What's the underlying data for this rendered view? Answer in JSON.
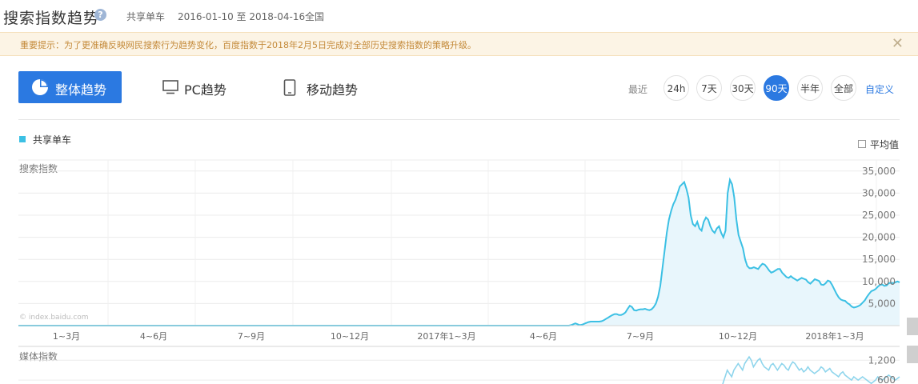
{
  "header": {
    "title": "搜索指数趋势",
    "help": "?",
    "keyword": "共享单车",
    "date_range": "2016-01-10 至 2018-04-16",
    "region": "全国"
  },
  "notice": {
    "text": "重要提示：为了更准确反映网民搜索行为趋势变化，百度指数于2018年2月5日完成对全部历史搜索指数的策略升级。",
    "close": "✕"
  },
  "tabs": {
    "overall": "整体趋势",
    "pc": "PC趋势",
    "mobile": "移动趋势"
  },
  "range": {
    "label": "最近",
    "options": [
      "24h",
      "7天",
      "30天",
      "90天",
      "半年",
      "全部"
    ],
    "active": "90天",
    "custom": "自定义"
  },
  "legend": {
    "series": "共享单车",
    "average": "平均值"
  },
  "watermark": "© index.baidu.com",
  "colors": {
    "accent": "#2b79e1",
    "series": "#3cc0e4",
    "fill": "#e8f6fc"
  },
  "chart_data": [
    {
      "type": "area",
      "ylabel": "搜索指数",
      "y_ticks": [
        "5,000",
        "10,000",
        "15,000",
        "20,000",
        "25,000",
        "30,000",
        "35,000"
      ],
      "ylim": [
        0,
        37500
      ],
      "x_tick_labels": [
        "1~3月",
        "4~6月",
        "7~9月",
        "10~12月",
        "2017年1~3月",
        "4~6月",
        "7~9月",
        "10~12月",
        "2018年1~3月"
      ],
      "series": [
        {
          "name": "共享单车",
          "values": [
            0,
            0,
            0,
            0,
            0,
            0,
            0,
            0,
            0,
            0,
            0,
            0,
            0,
            0,
            0,
            0,
            0,
            0,
            0,
            0,
            0,
            0,
            0,
            0,
            0,
            0,
            0,
            0,
            0,
            0,
            0,
            0,
            0,
            0,
            0,
            0,
            0,
            0,
            0,
            0,
            0,
            0,
            0,
            0,
            0,
            0,
            0,
            0,
            0,
            0,
            0,
            0,
            0,
            0,
            0,
            0,
            0,
            0,
            0,
            0,
            0,
            0,
            0,
            0,
            0,
            0,
            0,
            0,
            0,
            0,
            0,
            0,
            0,
            0,
            0,
            0,
            0,
            0,
            0,
            0,
            0,
            0,
            0,
            0,
            0,
            0,
            0,
            0,
            0,
            0,
            0,
            0,
            0,
            0,
            0,
            0,
            0,
            0,
            0,
            0,
            0,
            0,
            0,
            0,
            0,
            0,
            0,
            0,
            0,
            0,
            0,
            0,
            0,
            0,
            0,
            0,
            0,
            0,
            0,
            0,
            0,
            0,
            0,
            0,
            0,
            0,
            0,
            0,
            0,
            0,
            0,
            0,
            0,
            0,
            0,
            0,
            0,
            0,
            0,
            0,
            0,
            0,
            0,
            0,
            0,
            0,
            0,
            0,
            0,
            0,
            0,
            0,
            0,
            0,
            0,
            0,
            0,
            0,
            0,
            0,
            0,
            0,
            0,
            0,
            0,
            0,
            0,
            0,
            0,
            0,
            0,
            0,
            0,
            0,
            0,
            0,
            0,
            0,
            0,
            0,
            0,
            0,
            0,
            0,
            0,
            0,
            0,
            0,
            0,
            0,
            0,
            0,
            0,
            0,
            0,
            0,
            0,
            0,
            0,
            0,
            0,
            0,
            0,
            0,
            0,
            0,
            0,
            0,
            0,
            0,
            0,
            0,
            0,
            0,
            0,
            0,
            0,
            0,
            0,
            0,
            0,
            0,
            0,
            0,
            0,
            0,
            0,
            0,
            0,
            0,
            0,
            0,
            0,
            0,
            0,
            0,
            0,
            0,
            0,
            0,
            0,
            0,
            0,
            0,
            0,
            0,
            0,
            0,
            0,
            0,
            0,
            0,
            0,
            0,
            100,
            300,
            500,
            300,
            100,
            200,
            400,
            600,
            800,
            900,
            900,
            900,
            900,
            900,
            1000,
            1200,
            1500,
            1800,
            2100,
            2400,
            2600,
            2600,
            2400,
            2400,
            2600,
            3000,
            3800,
            4500,
            4200,
            3500,
            3400,
            3600,
            3700,
            3700,
            3800,
            3600,
            3500,
            3700,
            4200,
            5000,
            6500,
            9000,
            13000,
            17000,
            21000,
            24000,
            26000,
            27500,
            28500,
            30000,
            31500,
            32000,
            32500,
            31000,
            29000,
            25000,
            23000,
            22500,
            23500,
            22000,
            21500,
            23500,
            24500,
            24000,
            22500,
            21500,
            21000,
            22000,
            22500,
            21000,
            20000,
            21500,
            30000,
            33000,
            32000,
            29000,
            24000,
            20500,
            19000,
            17500,
            15000,
            13500,
            13000,
            13000,
            13200,
            13000,
            12800,
            13500,
            14000,
            13800,
            13200,
            12500,
            12000,
            12200,
            12500,
            12800,
            12800,
            12000,
            11500,
            11000,
            10800,
            11200,
            10800,
            10500,
            10200,
            10500,
            10800,
            10600,
            10400,
            9800,
            9500,
            10000,
            10500,
            10300,
            10100,
            9300,
            9200,
            9600,
            10200,
            10000,
            9200,
            8200,
            7200,
            6400,
            5900,
            5700,
            5600,
            5100,
            4800,
            4300,
            4100,
            4200,
            4400,
            4700,
            5200,
            5700,
            6500,
            7200,
            7800,
            8000,
            8300,
            8800,
            9200,
            9300,
            9000,
            9100,
            9600,
            9700,
            9600,
            9800,
            10000,
            9800
          ]
        }
      ]
    },
    {
      "type": "line",
      "ylabel": "媒体指数",
      "y_ticks": [
        "600",
        "1,200"
      ],
      "series": [
        {
          "name": "共享单车",
          "values": [
            0,
            0,
            0,
            0,
            0,
            0,
            0,
            0,
            0,
            0,
            0,
            0,
            0,
            0,
            0,
            0,
            0,
            0,
            0,
            0,
            0,
            0,
            0,
            0,
            0,
            0,
            0,
            0,
            0,
            0,
            0,
            0,
            0,
            0,
            0,
            0,
            0,
            0,
            0,
            0,
            0,
            0,
            0,
            0,
            0,
            0,
            0,
            0,
            0,
            0,
            0,
            0,
            0,
            0,
            0,
            0,
            0,
            0,
            0,
            0,
            0,
            0,
            0,
            0,
            0,
            0,
            0,
            0,
            0,
            0,
            0,
            0,
            0,
            0,
            0,
            0,
            0,
            0,
            0,
            0,
            0,
            0,
            0,
            0,
            0,
            0,
            0,
            0,
            0,
            0,
            0,
            0,
            0,
            0,
            0,
            0,
            0,
            0,
            0,
            0,
            0,
            0,
            0,
            0,
            0,
            0,
            0,
            0,
            0,
            0,
            0,
            0,
            0,
            0,
            0,
            0,
            0,
            0,
            0,
            0,
            0,
            0,
            0,
            0,
            0,
            0,
            0,
            0,
            0,
            0,
            0,
            0,
            0,
            0,
            0,
            0,
            0,
            0,
            0,
            0,
            0,
            0,
            0,
            0,
            0,
            0,
            0,
            0,
            0,
            0,
            0,
            0,
            0,
            0,
            0,
            0,
            0,
            0,
            0,
            0,
            0,
            0,
            0,
            0,
            0,
            0,
            0,
            0,
            0,
            0,
            0,
            0,
            0,
            0,
            0,
            0,
            0,
            0,
            0,
            0,
            0,
            0,
            0,
            0,
            0,
            0,
            0,
            0,
            0,
            0,
            0,
            0,
            0,
            0,
            0,
            0,
            0,
            0,
            0,
            0,
            0,
            0,
            0,
            0,
            0,
            0,
            0,
            0,
            0,
            0,
            0,
            0,
            0,
            0,
            0,
            0,
            0,
            0,
            0,
            0,
            0,
            0,
            0,
            0,
            0,
            0,
            0,
            0,
            0,
            0,
            0,
            0,
            0,
            0,
            0,
            0,
            0,
            0,
            0,
            0,
            0,
            0,
            0,
            0,
            0,
            0,
            0,
            0,
            0,
            0,
            0,
            0,
            0,
            0,
            0,
            0,
            0,
            0,
            0,
            0,
            0,
            0,
            0,
            0,
            0,
            0,
            0,
            0,
            0,
            0,
            0,
            0,
            0,
            0,
            0,
            0,
            0,
            0,
            0,
            0,
            0,
            0,
            0,
            0,
            0,
            0,
            0,
            0,
            0,
            0,
            0,
            0,
            0,
            0,
            0,
            0,
            0,
            0,
            0,
            0,
            0,
            0,
            0,
            0,
            0,
            0,
            0,
            0,
            0,
            0,
            0,
            0,
            0,
            0,
            0,
            0,
            0,
            0,
            0,
            0,
            100,
            200,
            300,
            500,
            700,
            900,
            800,
            700,
            900,
            1000,
            1100,
            1000,
            900,
            1100,
            1200,
            1300,
            1200,
            1000,
            1100,
            1200,
            1250,
            1100,
            1000,
            950,
            900,
            1050,
            1100,
            1000,
            900,
            1000,
            1100,
            1050,
            950,
            900,
            1050,
            1150,
            1100,
            1000,
            900,
            950,
            850,
            900,
            1000,
            900,
            850,
            800,
            850,
            900,
            1000,
            950,
            850,
            900,
            950,
            850,
            800,
            750,
            700,
            800,
            850,
            750,
            700,
            650,
            600,
            700,
            650,
            600,
            650,
            700,
            650,
            600,
            550,
            500,
            550,
            600,
            700,
            650,
            600,
            650,
            700,
            750,
            700,
            650,
            600,
            650,
            700
          ]
        }
      ]
    }
  ]
}
